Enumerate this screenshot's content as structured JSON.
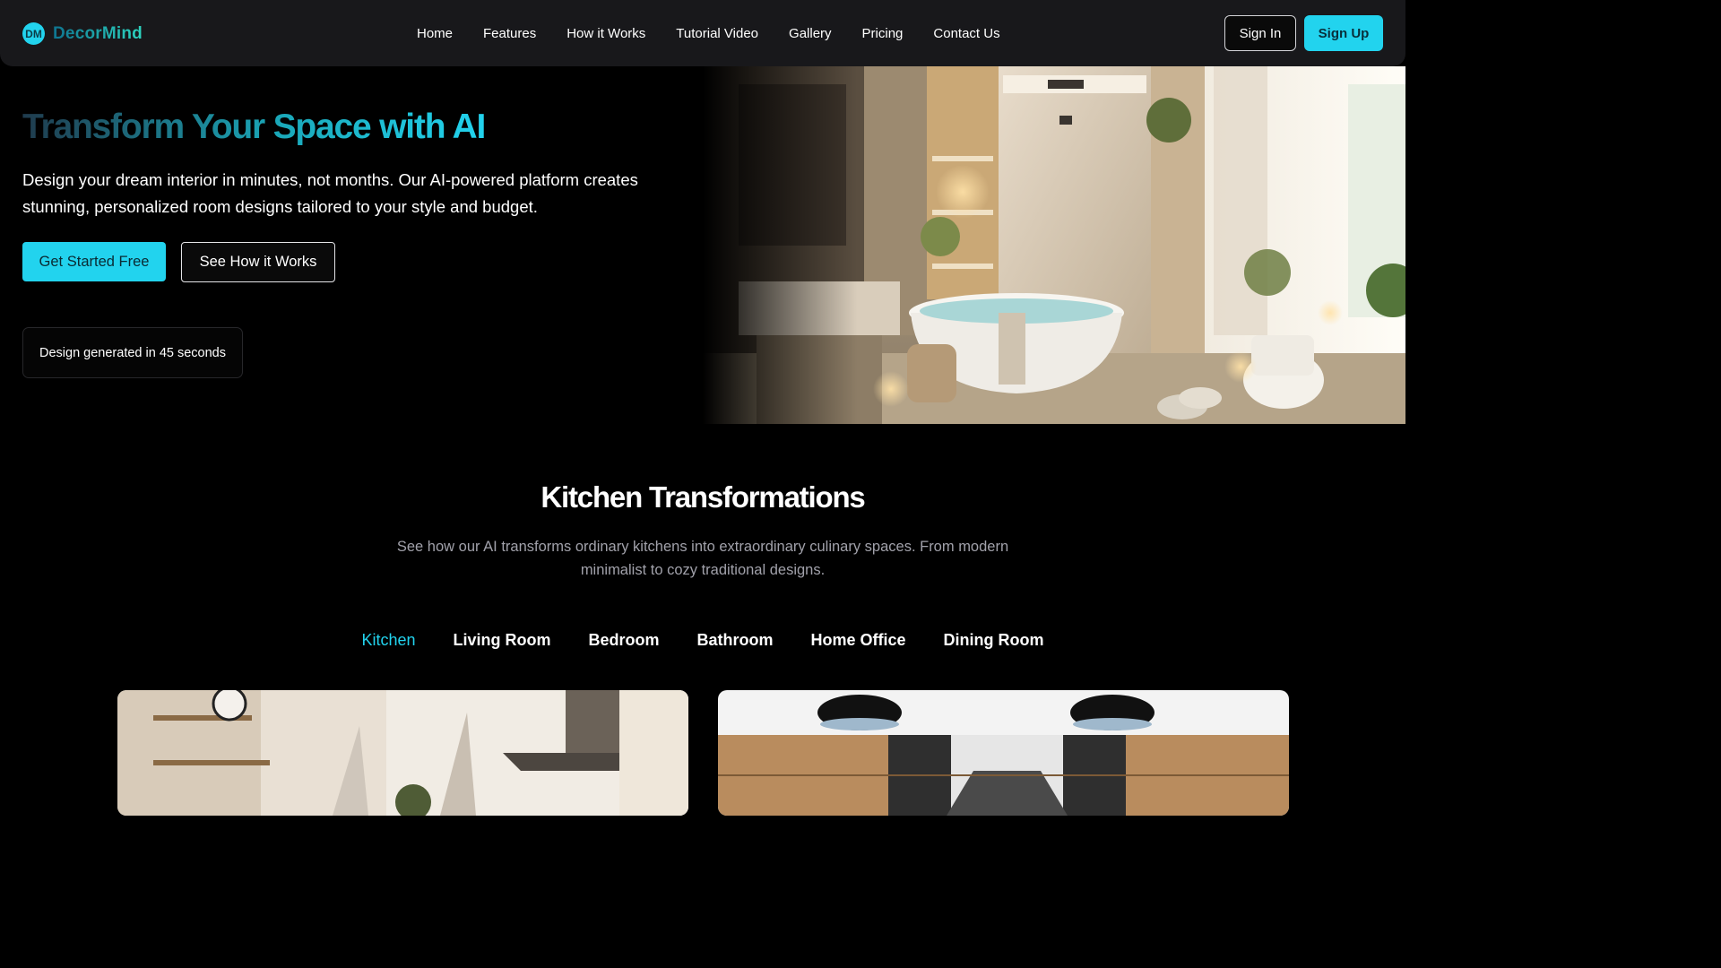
{
  "brand": {
    "badge": "DM",
    "name": "DecorMind"
  },
  "nav": {
    "links": [
      "Home",
      "Features",
      "How it Works",
      "Tutorial Video",
      "Gallery",
      "Pricing",
      "Contact Us"
    ],
    "sign_in": "Sign In",
    "sign_up": "Sign Up"
  },
  "hero": {
    "title": "Transform Your Space with AI",
    "subtitle": "Design your dream interior in minutes, not months. Our AI-powered platform creates stunning, personalized room designs tailored to your style and budget.",
    "primary_cta": "Get Started Free",
    "secondary_cta": "See How it Works",
    "badge_text": "Design generated in 45 seconds"
  },
  "section": {
    "title": "Kitchen Transformations",
    "subtitle": "See how our AI transforms ordinary kitchens into extraordinary culinary spaces. From modern minimalist to cozy traditional designs.",
    "tabs": [
      "Kitchen",
      "Living Room",
      "Bedroom",
      "Bathroom",
      "Home Office",
      "Dining Room"
    ],
    "active_tab": "Kitchen"
  },
  "colors": {
    "accent": "#22d3ee",
    "background": "#000000",
    "nav_bg": "#18181b"
  }
}
